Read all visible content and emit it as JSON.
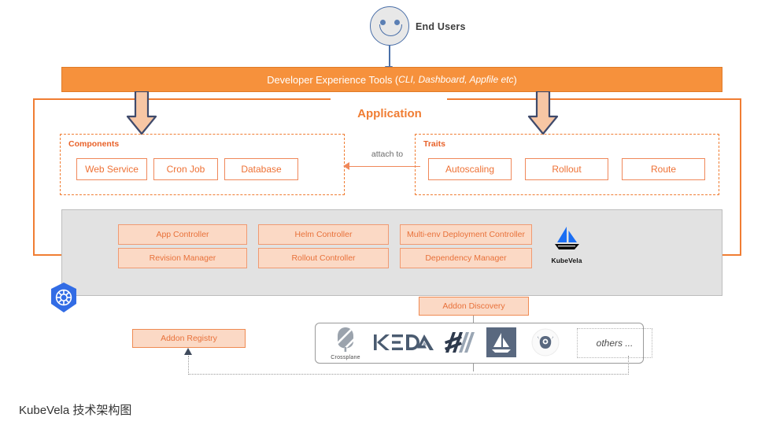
{
  "caption": "KubeVela 技术架构图",
  "end_users": {
    "label": "End Users",
    "icon": "smiley-face-icon"
  },
  "dx_bar": {
    "main_text": "Developer Experience Tools (",
    "italic_text": "CLI, Dashboard, Appfile etc",
    "close_text": ")"
  },
  "application": {
    "title": "Application",
    "components": {
      "caption": "Components",
      "chips": [
        "Web Service",
        "Cron Job",
        "Database"
      ]
    },
    "traits": {
      "caption": "Traits",
      "chips": [
        "Autoscaling",
        "Rollout",
        "Route"
      ]
    },
    "attach_label": "attach to"
  },
  "control_plane": {
    "controllers": [
      "App Controller",
      "Helm Controller",
      "Multi-env Deployment Controller",
      "Revision Manager",
      "Rollout Controller",
      "Dependency Manager"
    ],
    "kubevela_label": "KubeVela",
    "kubernetes_icon": "kubernetes-icon"
  },
  "addons": {
    "discovery_label": "Addon Discovery",
    "registry_label": "Addon Registry",
    "logos": [
      {
        "name": "crossplane-logo",
        "caption": "Crossplane"
      },
      {
        "name": "keda-logo",
        "caption": ""
      },
      {
        "name": "flagger-logo",
        "caption": ""
      },
      {
        "name": "helm-boat-logo",
        "caption": ""
      },
      {
        "name": "flux-owl-logo",
        "caption": ""
      }
    ],
    "others_label": "others ..."
  },
  "colors": {
    "orange": "#f07d33",
    "orange_bar": "#f6913c",
    "chip_border": "#f0885a",
    "chip_fill": "#fbd9c5",
    "blue": "#4a6fa8",
    "gray_band": "#e2e2e2",
    "k8s_blue": "#326ce5"
  }
}
